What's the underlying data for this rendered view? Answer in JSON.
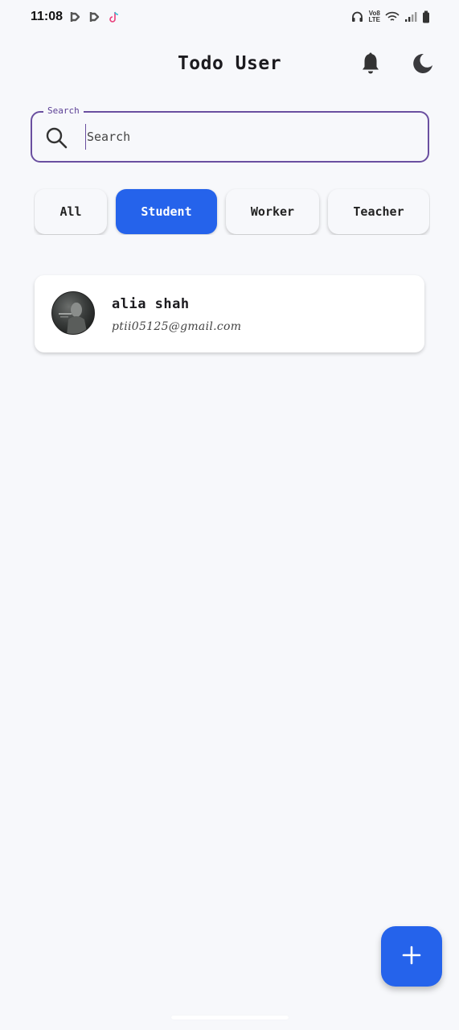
{
  "status_bar": {
    "time": "11:08",
    "left_icons": [
      "bbm-icon",
      "bbm-icon",
      "tiktok-icon"
    ],
    "right_icons": [
      "headphones-icon",
      "volte-icon",
      "wifi-icon",
      "signal-icon",
      "battery-icon"
    ],
    "volte_top": "Vo8",
    "volte_bottom": "LTE"
  },
  "app_bar": {
    "title": "Todo User",
    "actions": [
      "bell-icon",
      "moon-icon"
    ]
  },
  "search": {
    "label": "Search",
    "placeholder": "Search",
    "value": ""
  },
  "filters": {
    "selected": "Student",
    "items": [
      {
        "label": "All"
      },
      {
        "label": "Student"
      },
      {
        "label": "Worker"
      },
      {
        "label": "Teacher"
      }
    ]
  },
  "users": [
    {
      "name": "alia shah",
      "email": "ptii05125@gmail.com",
      "avatar": "user-avatar"
    }
  ],
  "fab": {
    "icon": "plus-icon"
  },
  "colors": {
    "accent": "#2563eb",
    "outline": "#6a4fa0",
    "background": "#f7f8fb"
  }
}
